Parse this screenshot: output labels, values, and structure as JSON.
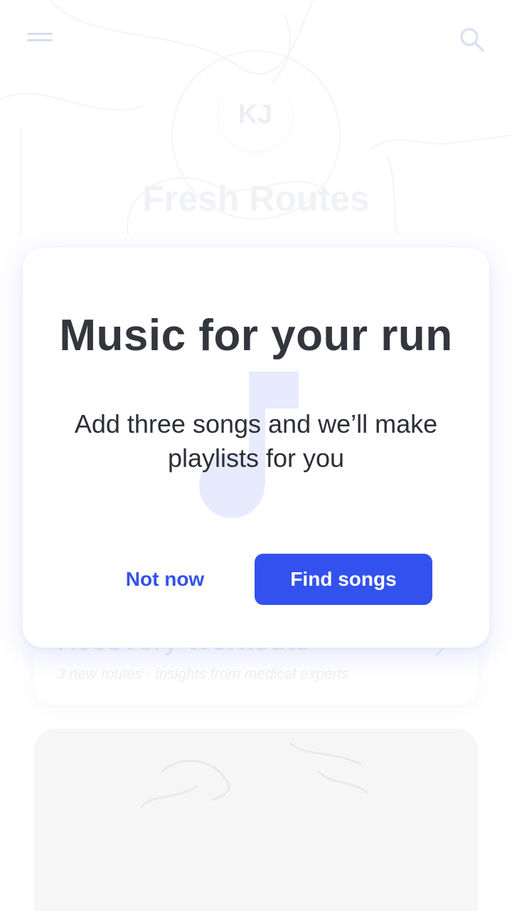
{
  "background": {
    "avatar_initials": "KJ",
    "title": "Fresh Routes",
    "card": {
      "title": "Recovery Workouts",
      "subtitle": "3 new routes · insights from medical experts"
    }
  },
  "modal": {
    "title": "Music for your run",
    "body": "Add three songs and we’ll make playlists for you",
    "secondary_label": "Not now",
    "primary_label": "Find songs"
  },
  "icons": {
    "menu": "hamburger-menu-icon",
    "search": "search-icon",
    "note": "music-note-icon",
    "chevron": "chevron-right-icon"
  },
  "colors": {
    "accent": "#3351ee",
    "note_tint": "#e8ebfd",
    "title_text": "#33363d"
  }
}
